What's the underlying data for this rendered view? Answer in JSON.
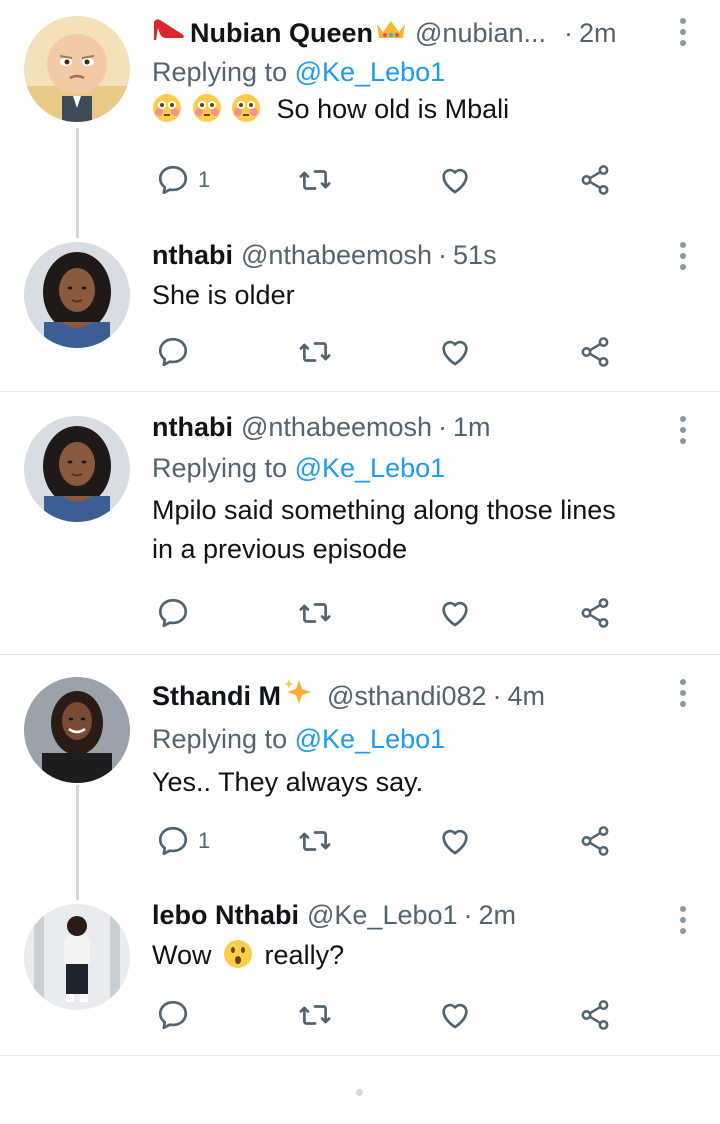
{
  "tweets": [
    {
      "name": "Nubian Queen",
      "handle": "@nubian...",
      "time": "2m",
      "replying_label": "Replying to",
      "replying_to": "@Ke_Lebo1",
      "text": "So how old is Mbali",
      "reply_count": "1",
      "avatar": "boss-baby-avatar"
    },
    {
      "name": "nthabi",
      "handle": "@nthabeemosh",
      "time": "51s",
      "text": "She is older",
      "reply_count": "",
      "avatar": "woman-curly-hair-avatar"
    },
    {
      "name": "nthabi",
      "handle": "@nthabeemosh",
      "time": "1m",
      "replying_label": "Replying to",
      "replying_to": "@Ke_Lebo1",
      "text_line1": "Mpilo said something along those lines",
      "text_line2": "in a previous episode",
      "reply_count": "",
      "avatar": "woman-curly-hair-avatar"
    },
    {
      "name": "Sthandi M",
      "handle": "@sthandi082",
      "time": "4m",
      "replying_label": "Replying to",
      "replying_to": "@Ke_Lebo1",
      "text": "Yes.. They always say.",
      "reply_count": "1",
      "avatar": "woman-smiling-avatar"
    },
    {
      "name": "lebo Nthabi",
      "handle": "@Ke_Lebo1",
      "time": "2m",
      "text_before": "Wow",
      "text_after": "really?",
      "reply_count": "",
      "avatar": "woman-mirror-selfie-avatar"
    }
  ],
  "colors": {
    "link": "#1d9bf0",
    "secondary_text": "#536471",
    "thread_line": "#cfd9de",
    "divider": "#e1e6ea"
  },
  "icons": {
    "reply": "reply-bubble-icon",
    "retweet": "retweet-icon",
    "like": "heart-icon",
    "share": "share-icon",
    "more": "more-vertical-icon"
  }
}
